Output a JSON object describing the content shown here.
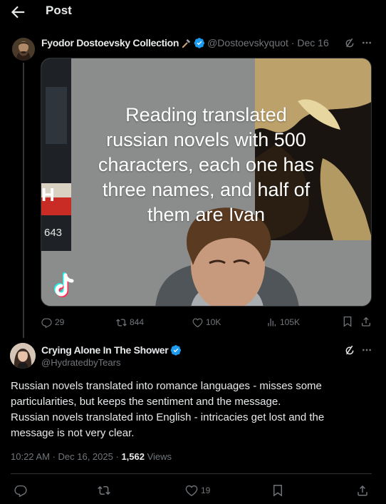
{
  "header": {
    "title": "Post"
  },
  "tweet": {
    "author_name": "Fyodor Dostoevsky Collection",
    "handle": "@Dostoevskyquot",
    "date": "Dec 16",
    "media": {
      "caption_lines": [
        "Reading translated",
        "russian novels with 500",
        "characters, each one has",
        "three names, and half of",
        "them are Ivan"
      ],
      "poster_text_1": "H",
      "poster_text_2": "643"
    },
    "stats": {
      "replies": "29",
      "reposts": "844",
      "likes": "10K",
      "views": "105K"
    }
  },
  "reply": {
    "author_name": "Crying Alone In The Shower",
    "handle": "@HydratedbyTears",
    "text_lines": [
      "Russian novels translated into romance languages - misses some",
      "particularities, but keeps the sentiment and the message.",
      "Russian novels translated into English - intricacies get lost and the",
      "message is not very clear."
    ],
    "time": "10:22 AM",
    "date": "Dec 16, 2025",
    "views_count": "1,562",
    "views_label": "Views",
    "likes": "19"
  },
  "colors": {
    "background": "#000000",
    "text": "#e7e9ea",
    "muted": "#71767b",
    "verified": "#1d9bf0",
    "divider": "#2f3336"
  }
}
